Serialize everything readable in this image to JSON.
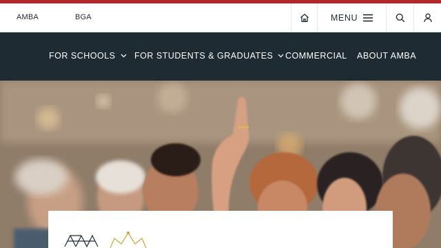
{
  "utility_bar": {
    "brands": [
      "AMBA",
      "BGA"
    ],
    "menu_label": "MENU",
    "icons": [
      "home-icon",
      "hamburger-icon",
      "search-icon",
      "account-icon"
    ]
  },
  "main_nav": {
    "items": [
      {
        "label": "FOR SCHOOLS",
        "has_dropdown": true
      },
      {
        "label": "FOR STUDENTS & GRADUATES",
        "has_dropdown": true
      },
      {
        "label": "COMMERCIAL",
        "has_dropdown": false
      },
      {
        "label": "ABOUT AMBA",
        "has_dropdown": false
      }
    ]
  },
  "hero": {
    "image": "audience with a raised hand"
  },
  "colors": {
    "accent_red": "#b3262b",
    "nav_background": "#1e2b33",
    "crown_gold": "#c9a545"
  }
}
